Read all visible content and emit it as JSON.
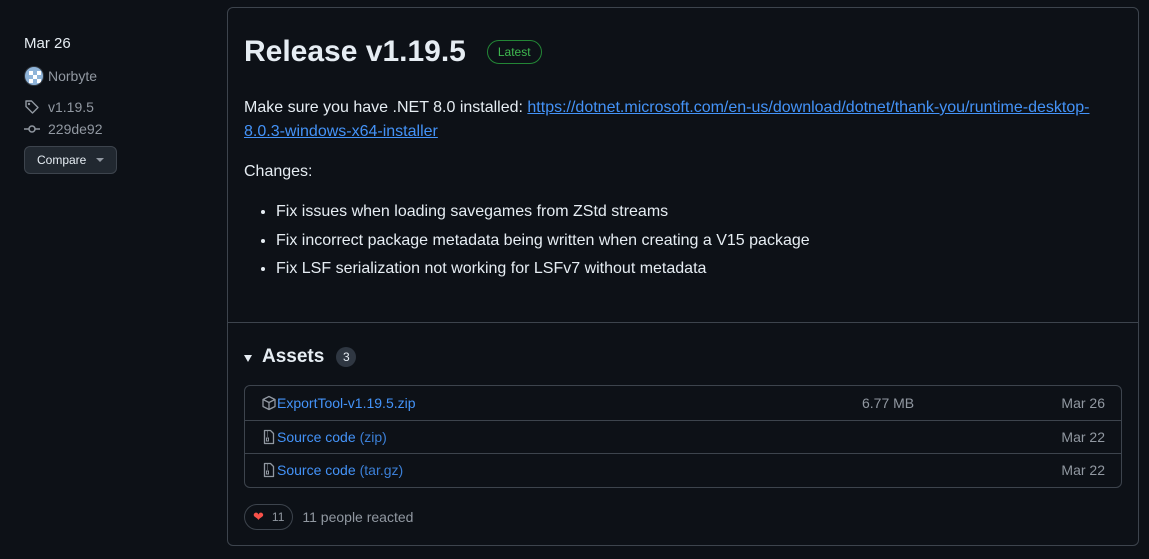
{
  "sidebar": {
    "date": "Mar 26",
    "author": "Norbyte",
    "tag": "v1.19.5",
    "commit": "229de92",
    "compare_label": "Compare"
  },
  "release": {
    "title": "Release v1.19.5",
    "latest_label": "Latest",
    "intro_text": "Make sure you have .NET 8.0 installed: ",
    "link_text": "https://dotnet.microsoft.com/en-us/download/dotnet/thank-you/runtime-desktop-8.0.3-windows-x64-installer",
    "changes_heading": "Changes:",
    "changes": [
      "Fix issues when loading savegames from ZStd streams",
      "Fix incorrect package metadata being written when creating a V15 package",
      "Fix LSF serialization not working for LSFv7 without metadata"
    ]
  },
  "assets": {
    "title": "Assets",
    "count": "3",
    "items": [
      {
        "name": "ExportTool-v1.19.5.zip",
        "extra": "",
        "size": "6.77 MB",
        "date": "Mar 26",
        "icon": "package-icon"
      },
      {
        "name": "Source code",
        "extra": "(zip)",
        "size": "",
        "date": "Mar 22",
        "icon": "file-zip-icon"
      },
      {
        "name": "Source code",
        "extra": "(tar.gz)",
        "size": "",
        "date": "Mar 22",
        "icon": "file-zip-icon"
      }
    ]
  },
  "reactions": {
    "count": "11",
    "text": "11 people reacted"
  },
  "colors": {
    "background": "#0d1117",
    "link": "#4493f8",
    "latest_badge": "#3fb950",
    "heart": "#f85149"
  }
}
